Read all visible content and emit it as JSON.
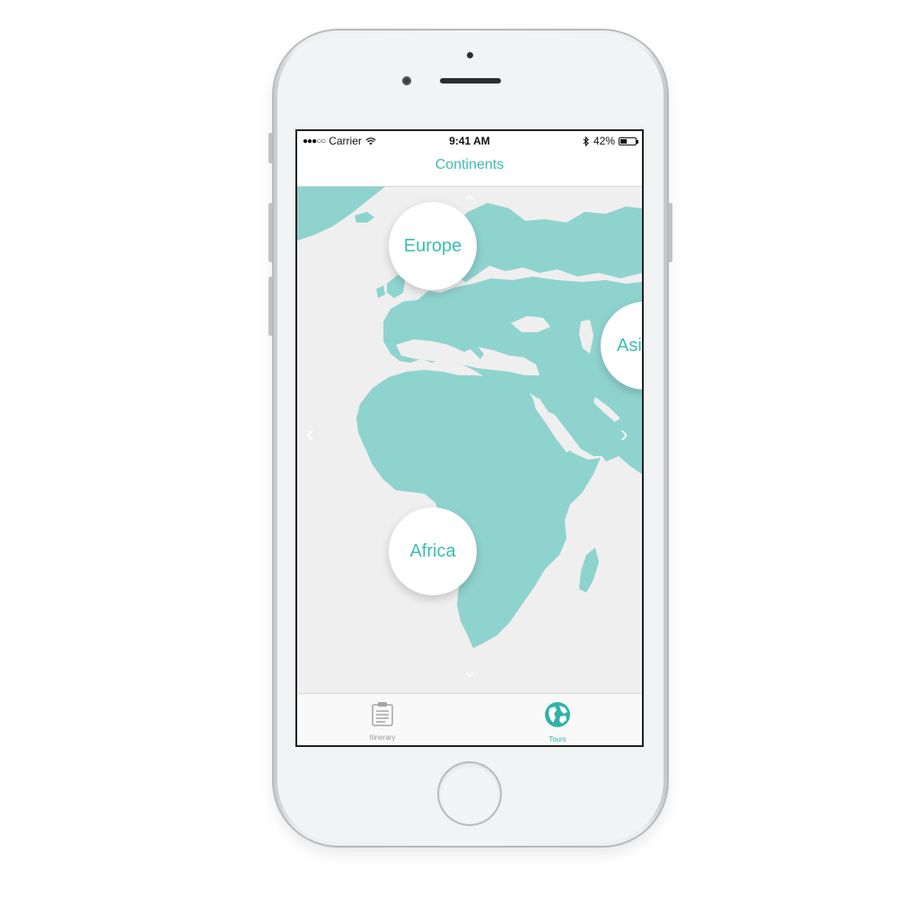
{
  "status_bar": {
    "signal": "●●●○○",
    "carrier": "Carrier",
    "time": "9:41 AM",
    "battery_percent": "42%",
    "battery_level": 0.42
  },
  "nav": {
    "title": "Continents"
  },
  "map": {
    "continents": [
      {
        "label": "Europe"
      },
      {
        "label": "Asi"
      },
      {
        "label": "Africa"
      }
    ],
    "arrows": {
      "up": "⌃",
      "down": "⌄",
      "left": "‹",
      "right": "›"
    }
  },
  "tab_bar": {
    "items": [
      {
        "label": "Itinerary",
        "icon": "clipboard-icon",
        "active": false
      },
      {
        "label": "Tours",
        "icon": "globe-icon",
        "active": true
      }
    ]
  },
  "colors": {
    "accent": "#3cbdb2",
    "land": "#8fd3cf",
    "sea": "#efefef"
  }
}
